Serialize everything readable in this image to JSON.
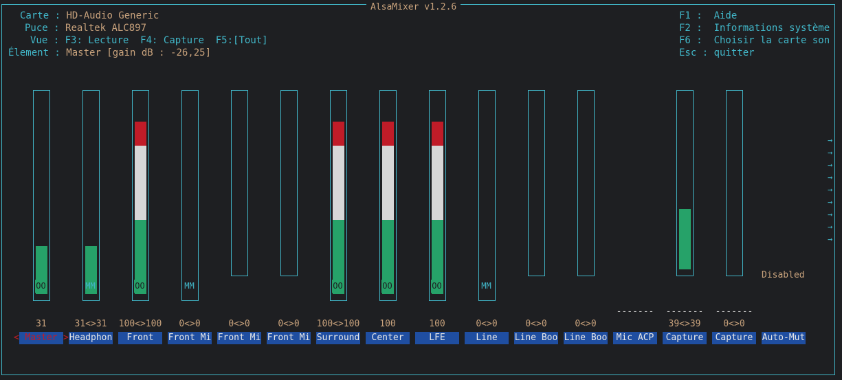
{
  "window": {
    "title": "AlsaMixer v1.2.6"
  },
  "info": {
    "carte_label": "Carte :",
    "carte_value": "HD-Audio Generic",
    "puce_label": "Puce :",
    "puce_value": "Realtek ALC897",
    "vue_label": "Vue :",
    "vue_f3": "F3: Lecture",
    "vue_f4": "F4: Capture",
    "vue_f5": "F5:[Tout]",
    "element_label": "Élement :",
    "element_value": "Master [gain dB : -26,25]"
  },
  "help": [
    {
      "key": "F1 :",
      "text": "Aide"
    },
    {
      "key": "F2 :",
      "text": "Informations système"
    },
    {
      "key": "F6 :",
      "text": "Choisir la carte son"
    },
    {
      "key": "Esc :",
      "text": "quitter"
    }
  ],
  "colors": {
    "border": "#41b6c8",
    "label": "#c8a27c",
    "green": "#26a269",
    "white": "#d7d7d7",
    "red": "#c01c28",
    "name_bg": "#1f4ea1"
  },
  "controls": [
    {
      "name": "Master",
      "value": "31",
      "level": 0.28,
      "mute": "OO",
      "mute_on": true,
      "selected": true
    },
    {
      "name": "Headphon",
      "value": "31<>31",
      "level": 0.28,
      "mute": "MM",
      "mute_on": false
    },
    {
      "name": "Front",
      "value": "100<>100",
      "level": 1.0,
      "mute": "OO",
      "mute_on": true
    },
    {
      "name": "Front Mi",
      "value": "0<>0",
      "level": 0,
      "mute": "MM",
      "mute_on": false
    },
    {
      "name": "Front Mi",
      "value": "0<>0",
      "level": 0,
      "mute": "",
      "mute_on": false
    },
    {
      "name": "Front Mi",
      "value": "0<>0",
      "level": 0,
      "mute": "",
      "mute_on": false
    },
    {
      "name": "Surround",
      "value": "100<>100",
      "level": 1.0,
      "mute": "OO",
      "mute_on": true
    },
    {
      "name": "Center",
      "value": "100",
      "level": 1.0,
      "mute": "OO",
      "mute_on": true
    },
    {
      "name": "LFE",
      "value": "100",
      "level": 1.0,
      "mute": "OO",
      "mute_on": true
    },
    {
      "name": "Line",
      "value": "0<>0",
      "level": 0,
      "mute": "MM",
      "mute_on": false
    },
    {
      "name": "Line Boo",
      "value": "0<>0",
      "level": 0,
      "mute": "",
      "mute_on": false
    },
    {
      "name": "Line Boo",
      "value": "0<>0",
      "level": 0,
      "mute": "",
      "mute_on": false
    },
    {
      "name": "Mic ACP",
      "value": "-------",
      "level": null,
      "mute": "",
      "mute_on": false
    },
    {
      "name": "Capture",
      "value": "39<>39",
      "dash": "-------",
      "level": 0.35,
      "mute": "",
      "mute_on": false
    },
    {
      "name": "Capture",
      "value": "0<>0",
      "dash": "-------",
      "level": 0,
      "mute": "",
      "mute_on": false
    },
    {
      "name": "Auto-Mut",
      "value": "Disabled",
      "level": null,
      "mute": "",
      "mute_on": false
    }
  ],
  "scroll_arrows": "→→→→→→→→→"
}
